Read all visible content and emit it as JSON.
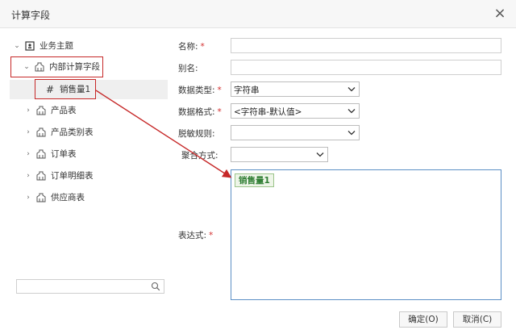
{
  "dialog": {
    "title": "计算字段",
    "close_icon": "×"
  },
  "tree": {
    "root_label": "业务主题",
    "folder_label": "内部计算字段",
    "field_prefix": "#",
    "field_label": "销售量1",
    "tables": [
      "产品表",
      "产品类别表",
      "订单表",
      "订单明细表",
      "供应商表"
    ]
  },
  "search": {
    "placeholder": ""
  },
  "form": {
    "name_label": "名称:",
    "alias_label": "别名:",
    "datatype_label": "数据类型:",
    "datatype_value": "字符串",
    "format_label": "数据格式:",
    "format_value": "<字符串-默认值>",
    "mask_label": "脱敏规则:",
    "agg_label": "聚合方式:",
    "expr_label": "表达式:",
    "required_mark": "*"
  },
  "expression": {
    "token": "销售量1"
  },
  "buttons": {
    "ok": "确定(O)",
    "cancel": "取消(C)"
  },
  "colors": {
    "highlight": "#c62828",
    "token_text": "#2e7d32",
    "expr_border": "#5b8fc5"
  }
}
